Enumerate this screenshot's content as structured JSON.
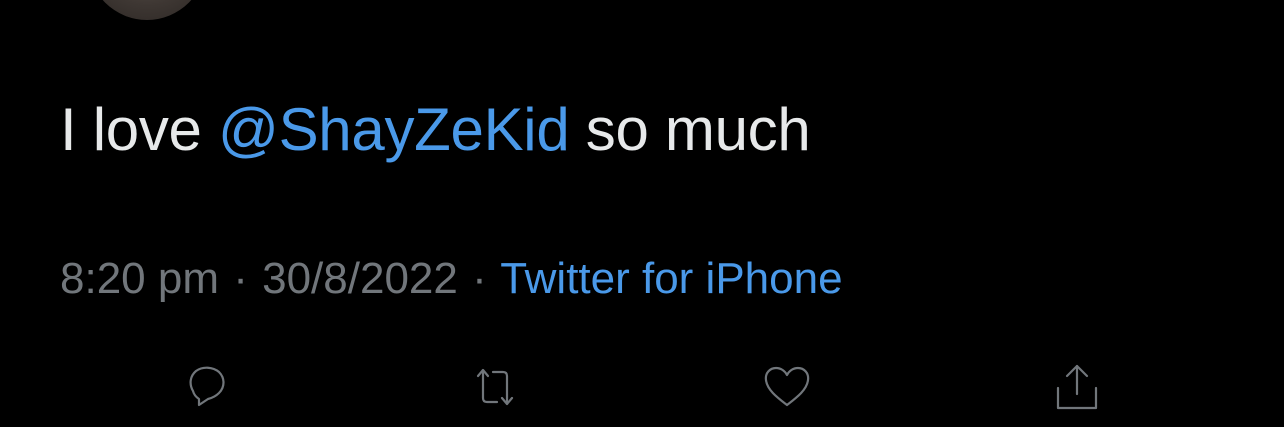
{
  "tweet": {
    "text_before": "I love ",
    "mention": "@ShayZeKid",
    "text_after": " so much"
  },
  "meta": {
    "time": "8:20 pm",
    "separator": "·",
    "date": "30/8/2022",
    "source": "Twitter for iPhone"
  },
  "colors": {
    "background": "#000000",
    "text": "#e7e9ea",
    "link": "#4a99e9",
    "muted": "#71767b"
  },
  "actions": [
    {
      "name": "reply",
      "icon": "reply-icon"
    },
    {
      "name": "retweet",
      "icon": "retweet-icon"
    },
    {
      "name": "like",
      "icon": "heart-icon"
    },
    {
      "name": "share",
      "icon": "share-icon"
    }
  ]
}
